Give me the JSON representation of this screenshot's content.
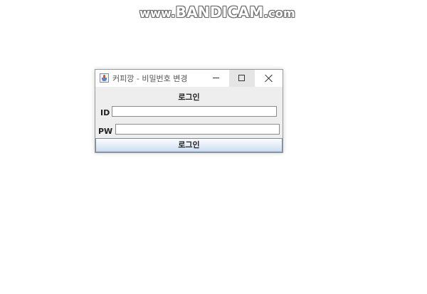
{
  "watermark": {
    "prefix": "www.",
    "brand": "BANDICAM",
    "suffix": ".com"
  },
  "window": {
    "title": "커피깡 - 비밀번호 변경",
    "icon": "java-cup-icon",
    "controls": {
      "minimize_icon": "minimize-icon",
      "maximize_icon": "maximize-icon",
      "close_icon": "close-icon"
    }
  },
  "form": {
    "heading": "로그인",
    "id_label": "ID",
    "id_value": "",
    "pw_label": "PW",
    "pw_value": "",
    "submit_label": "로그인"
  }
}
